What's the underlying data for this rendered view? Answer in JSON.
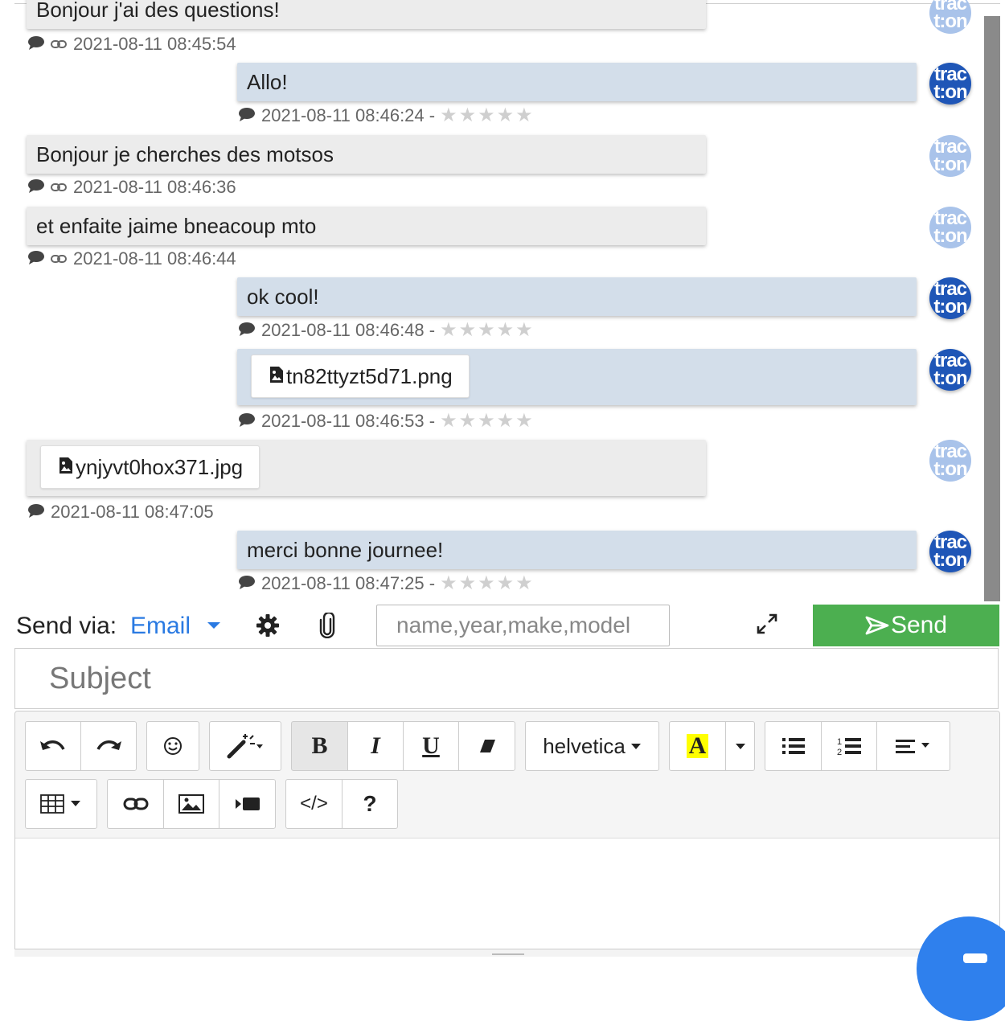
{
  "messages": [
    {
      "dir": "in",
      "text": "Bonjour j'ai des questions!",
      "time": "2021-08-11 08:45:54"
    },
    {
      "dir": "out",
      "text": "Allo!",
      "time": "2021-08-11 08:46:24 -",
      "rating": 0
    },
    {
      "dir": "in",
      "text": "Bonjour je cherches des motsos",
      "time": "2021-08-11 08:46:36"
    },
    {
      "dir": "in",
      "text": "et enfaite jaime bneacoup mto",
      "time": "2021-08-11 08:46:44"
    },
    {
      "dir": "out",
      "text": "ok cool!",
      "time": "2021-08-11 08:46:48 -",
      "rating": 0
    },
    {
      "dir": "out",
      "file": "tn82ttyzt5d71.png",
      "time": "2021-08-11 08:46:53 -",
      "rating": 0
    },
    {
      "dir": "in",
      "file": "ynjyvt0hox371.jpg",
      "time": "2021-08-11 08:47:05"
    },
    {
      "dir": "out",
      "text": "merci bonne journee!",
      "time": "2021-08-11 08:47:25 -",
      "rating": 0
    }
  ],
  "avatar": {
    "line1": "trac",
    "line2": "t:on"
  },
  "send_bar": {
    "label": "Send via:",
    "channel": "Email",
    "search_placeholder": "name,year,make,model",
    "send_label": "Send"
  },
  "subject": {
    "placeholder": "Subject"
  },
  "editor_toolbar": {
    "font_name": "helvetica",
    "bold": "B",
    "italic": "I",
    "underline": "U",
    "highlight": "A",
    "help": "?",
    "code": "</>"
  },
  "colors": {
    "incoming_bubble": "#ececec",
    "outgoing_bubble": "#d3deea",
    "send_button": "#4caf50",
    "link_blue": "#2a7ae2",
    "avatar_blue": "#1f56b7"
  }
}
